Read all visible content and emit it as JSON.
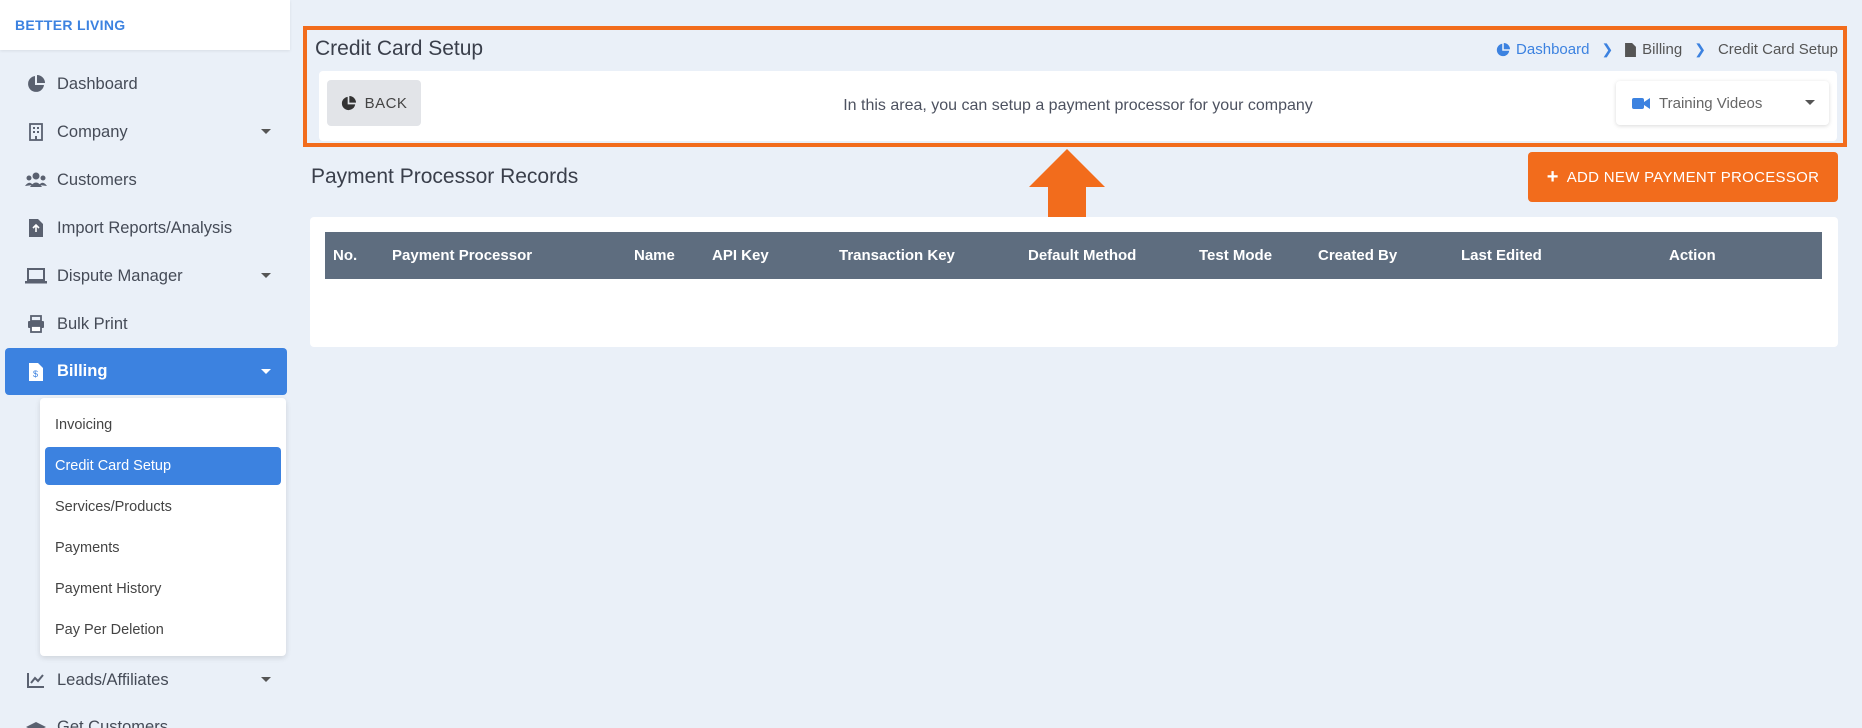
{
  "brand": "BETTER LIVING",
  "sidebar": {
    "items": [
      {
        "label": "Dashboard",
        "icon": "dashboard-pie-icon"
      },
      {
        "label": "Company",
        "icon": "building-icon"
      },
      {
        "label": "Customers",
        "icon": "users-icon"
      },
      {
        "label": "Import Reports/Analysis",
        "icon": "file-import-icon"
      },
      {
        "label": "Dispute Manager",
        "icon": "laptop-icon"
      },
      {
        "label": "Bulk Print",
        "icon": "printer-icon"
      },
      {
        "label": "Billing",
        "icon": "invoice-icon"
      },
      {
        "label": "Leads/Affiliates",
        "icon": "chart-line-icon"
      },
      {
        "label": "Get Customers",
        "icon": "graduation-icon"
      }
    ],
    "billing_submenu": [
      {
        "label": "Invoicing"
      },
      {
        "label": "Credit Card Setup"
      },
      {
        "label": "Services/Products"
      },
      {
        "label": "Payments"
      },
      {
        "label": "Payment History"
      },
      {
        "label": "Pay Per Deletion"
      }
    ]
  },
  "header": {
    "title": "Credit Card Setup",
    "breadcrumb": [
      "Dashboard",
      "Billing",
      "Credit Card Setup"
    ],
    "back_label": "BACK",
    "info_text": "In this area, you can setup a payment processor for your company",
    "training_videos_label": "Training Videos"
  },
  "records": {
    "title": "Payment Processor Records",
    "add_button_label": "ADD NEW PAYMENT PROCESSOR",
    "columns": [
      "No.",
      "Payment Processor",
      "Name",
      "API Key",
      "Transaction Key",
      "Default Method",
      "Test Mode",
      "Created By",
      "Last Edited",
      "Action"
    ],
    "rows": []
  },
  "colors": {
    "accent": "#3c82e0",
    "highlight": "#f26c1c",
    "table_header": "#5e6d7f"
  }
}
